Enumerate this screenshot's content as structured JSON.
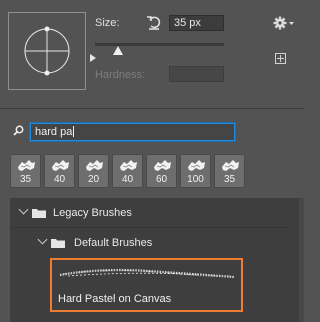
{
  "brush_settings": {
    "size_label": "Size:",
    "size_value": "35 px",
    "size_slider_fraction": 0.18,
    "hardness_label": "Hardness:",
    "hardness_value": "",
    "icons": [
      "brush-angle-roundness-icon",
      "reset-icon",
      "gear-icon",
      "new-preset-icon"
    ]
  },
  "search": {
    "value": "hard pa",
    "icon": "search-icon"
  },
  "recent_brushes": [
    {
      "size": "35"
    },
    {
      "size": "40"
    },
    {
      "size": "20"
    },
    {
      "size": "40"
    },
    {
      "size": "60"
    },
    {
      "size": "100"
    },
    {
      "size": "35"
    }
  ],
  "brush_list": {
    "group": "Legacy Brushes",
    "subgroup": "Default Brushes",
    "selected_brush": "Hard Pastel on Canvas"
  },
  "colors": {
    "panel_bg": "#535353",
    "list_bg": "#3e3e3e",
    "selection_border": "#ed7d31",
    "search_focus": "#1f8be0"
  }
}
